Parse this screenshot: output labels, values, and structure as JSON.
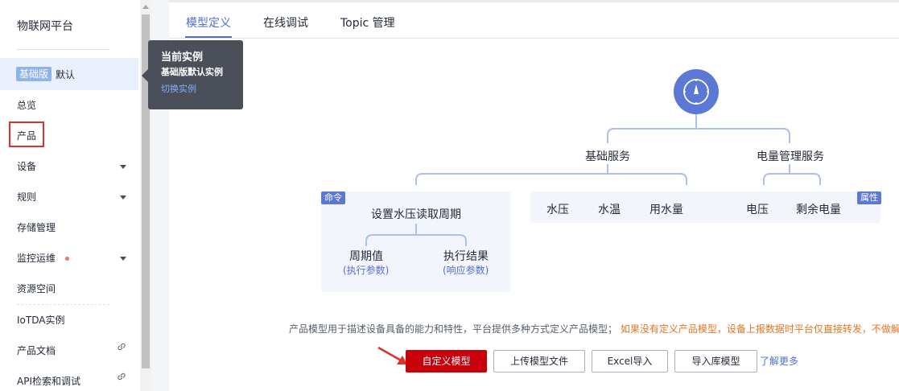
{
  "sidebar": {
    "platform_title": "物联网平台",
    "edition_badge": "基础版",
    "instance_name": "默认",
    "items": [
      {
        "label": "总览"
      },
      {
        "label": "产品"
      },
      {
        "label": "设备"
      },
      {
        "label": "规则"
      },
      {
        "label": "存储管理"
      },
      {
        "label": "监控运维"
      },
      {
        "label": "资源空间"
      },
      {
        "label": "IoTDA实例"
      },
      {
        "label": "产品文档"
      },
      {
        "label": "API检索和调试"
      }
    ]
  },
  "tooltip": {
    "title": "当前实例",
    "subtitle": "基础版默认实例",
    "link": "切换实例"
  },
  "tabs": [
    {
      "label": "模型定义",
      "active": true
    },
    {
      "label": "在线调试",
      "active": false
    },
    {
      "label": "Topic 管理",
      "active": false
    }
  ],
  "diagram": {
    "service_basic": "基础服务",
    "service_power": "电量管理服务",
    "command_tag": "命令",
    "property_tag": "属性",
    "command_name": "设置水压读取周期",
    "param_in": "周期值",
    "param_in_sub": "(执行参数)",
    "param_out": "执行结果",
    "param_out_sub": "(响应参数)",
    "props": [
      "水压",
      "水温",
      "用水量",
      "电压",
      "剩余电量"
    ]
  },
  "description": {
    "text": "产品模型用于描述设备具备的能力和特性，平台提供多种方式定义产品模型；",
    "warning": "如果没有定义产品模型，设备上报数据时平台仅直接转发，不做解"
  },
  "actions": {
    "custom_model": "自定义模型",
    "upload_model": "上传模型文件",
    "excel_import": "Excel导入",
    "import_library": "导入库模型",
    "learn_more": "了解更多"
  },
  "colors": {
    "accent": "#526ecc",
    "primary_button": "#c7000b",
    "highlight_box": "#e0302c",
    "warning_text": "#e8731e"
  }
}
